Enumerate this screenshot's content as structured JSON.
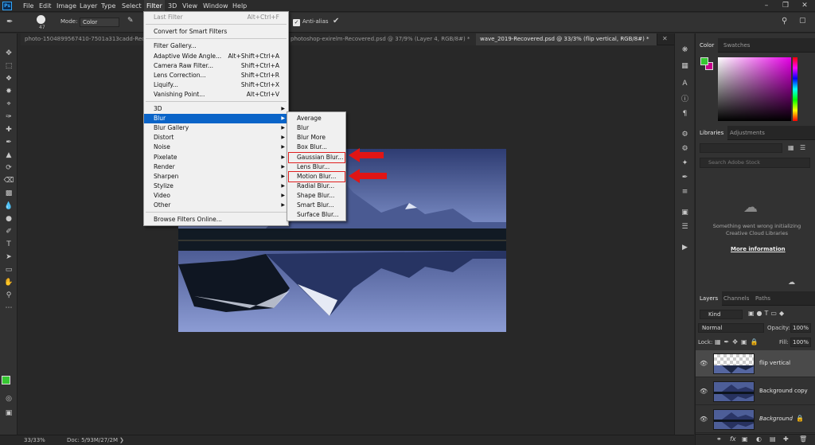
{
  "app": {
    "logo": "Ps"
  },
  "menubar": {
    "items": [
      "File",
      "Edit",
      "Image",
      "Layer",
      "Type",
      "Select",
      "Filter",
      "3D",
      "View",
      "Window",
      "Help"
    ],
    "active": "Filter",
    "window_controls": [
      "–",
      "❐",
      "✕"
    ]
  },
  "options": {
    "brush_size": "47",
    "mode_label": "Mode:",
    "mode_value": "Color",
    "antialias_label": "Anti-alias"
  },
  "tabs": [
    {
      "label": "photo-1504899567410-7501a313cadd-Recovered..."
    },
    {
      "label": "photoshop-exirelm-Recovered.psd @ 37/9% (Layer 4, RGB/8#) *"
    },
    {
      "label": "wave_2019-Recovered.psd @ 33/3% (flip vertical, RGB/8#) *"
    }
  ],
  "filter_menu": {
    "items": [
      {
        "label": "Last Filter",
        "shortcut": "Alt+Ctrl+F",
        "disabled": true
      },
      {
        "sep": true
      },
      {
        "label": "Convert for Smart Filters"
      },
      {
        "sep": true
      },
      {
        "label": "Filter Gallery..."
      },
      {
        "label": "Adaptive Wide Angle...",
        "shortcut": "Alt+Shift+Ctrl+A"
      },
      {
        "label": "Camera Raw Filter...",
        "shortcut": "Shift+Ctrl+A"
      },
      {
        "label": "Lens Correction...",
        "shortcut": "Shift+Ctrl+R"
      },
      {
        "label": "Liquify...",
        "shortcut": "Shift+Ctrl+X"
      },
      {
        "label": "Vanishing Point...",
        "shortcut": "Alt+Ctrl+V"
      },
      {
        "sep": true
      },
      {
        "label": "3D",
        "submenu": true
      },
      {
        "label": "Blur",
        "submenu": true,
        "highlighted": true
      },
      {
        "label": "Blur Gallery",
        "submenu": true
      },
      {
        "label": "Distort",
        "submenu": true
      },
      {
        "label": "Noise",
        "submenu": true
      },
      {
        "label": "Pixelate",
        "submenu": true
      },
      {
        "label": "Render",
        "submenu": true
      },
      {
        "label": "Sharpen",
        "submenu": true
      },
      {
        "label": "Stylize",
        "submenu": true
      },
      {
        "label": "Video",
        "submenu": true
      },
      {
        "label": "Other",
        "submenu": true
      },
      {
        "sep": true
      },
      {
        "label": "Browse Filters Online..."
      }
    ]
  },
  "blur_submenu": {
    "items": [
      "Average",
      "Blur",
      "Blur More",
      "Box Blur...",
      "Gaussian Blur...",
      "Lens Blur...",
      "Motion Blur...",
      "Radial Blur...",
      "Shape Blur...",
      "Smart Blur...",
      "Surface Blur..."
    ],
    "marked": [
      "Gaussian Blur...",
      "Motion Blur..."
    ]
  },
  "status": {
    "zoom": "33/33%",
    "doc": "Doc: 5/93M/27/2M"
  },
  "color_panel": {
    "tabs": [
      "Color",
      "Swatches"
    ],
    "fg": "#36c832",
    "bg": "#c8008c"
  },
  "libraries_panel": {
    "tabs": [
      "Libraries",
      "Adjustments"
    ],
    "search_placeholder": "Search Adobe Stock",
    "error": "Something went wrong initializing Creative Cloud Libraries",
    "more_info": "More information"
  },
  "layers_panel": {
    "tabs": [
      "Layers",
      "Channels",
      "Paths"
    ],
    "kind": "Kind",
    "blend": "Normal",
    "opacity_label": "Opacity:",
    "opacity": "100%",
    "lock_label": "Lock:",
    "fill_label": "Fill:",
    "fill": "100%",
    "layers": [
      {
        "name": "flip vertical",
        "selected": true
      },
      {
        "name": "Background copy"
      },
      {
        "name": "Background",
        "locked": true
      }
    ],
    "footer_icons": [
      "link",
      "fx",
      "mask",
      "adjust",
      "group",
      "new",
      "trash"
    ]
  }
}
